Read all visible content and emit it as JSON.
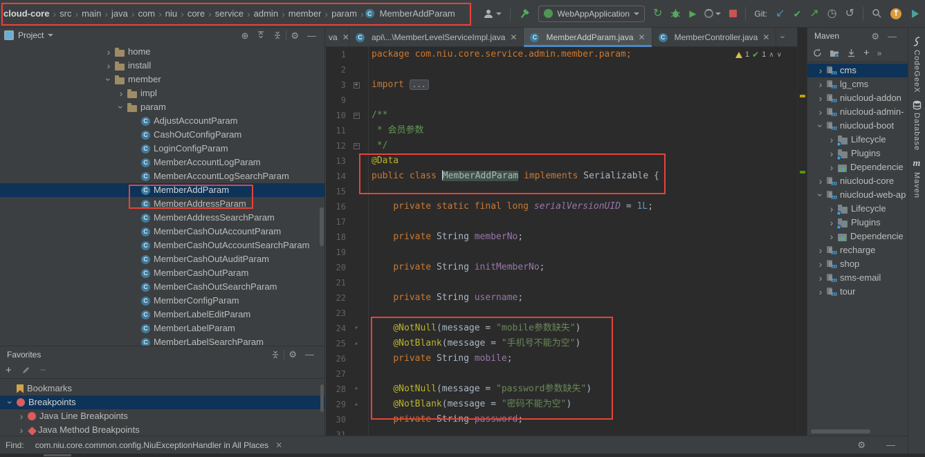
{
  "breadcrumbs": {
    "items": [
      "cloud-core",
      "src",
      "main",
      "java",
      "com",
      "niu",
      "core",
      "service",
      "admin",
      "member",
      "param",
      "MemberAddParam"
    ]
  },
  "toolbar": {
    "run_config": "WebAppApplication",
    "git_label": "Git:"
  },
  "project_panel": {
    "title": "Project"
  },
  "project_tree": {
    "items": [
      {
        "lv": 1,
        "chev": "r",
        "icon": "folder",
        "label": "home"
      },
      {
        "lv": 1,
        "chev": "r",
        "icon": "folder",
        "label": "install"
      },
      {
        "lv": 1,
        "chev": "d",
        "icon": "folder",
        "label": "member"
      },
      {
        "lv": 2,
        "chev": "r",
        "icon": "folder",
        "label": "impl"
      },
      {
        "lv": 2,
        "chev": "d",
        "icon": "folder",
        "label": "param"
      },
      {
        "lv": 3,
        "icon": "class",
        "label": "AdjustAccountParam"
      },
      {
        "lv": 3,
        "icon": "class",
        "label": "CashOutConfigParam"
      },
      {
        "lv": 3,
        "icon": "class",
        "label": "LoginConfigParam"
      },
      {
        "lv": 3,
        "icon": "class",
        "label": "MemberAccountLogParam"
      },
      {
        "lv": 3,
        "icon": "class",
        "label": "MemberAccountLogSearchParam"
      },
      {
        "lv": 3,
        "icon": "class",
        "label": "MemberAddParam",
        "sel": true
      },
      {
        "lv": 3,
        "icon": "class",
        "label": "MemberAddressParam"
      },
      {
        "lv": 3,
        "icon": "class",
        "label": "MemberAddressSearchParam"
      },
      {
        "lv": 3,
        "icon": "class",
        "label": "MemberCashOutAccountParam"
      },
      {
        "lv": 3,
        "icon": "class",
        "label": "MemberCashOutAccountSearchParam"
      },
      {
        "lv": 3,
        "icon": "class",
        "label": "MemberCashOutAuditParam"
      },
      {
        "lv": 3,
        "icon": "class",
        "label": "MemberCashOutParam"
      },
      {
        "lv": 3,
        "icon": "class",
        "label": "MemberCashOutSearchParam"
      },
      {
        "lv": 3,
        "icon": "class",
        "label": "MemberConfigParam"
      },
      {
        "lv": 3,
        "icon": "class",
        "label": "MemberLabelEditParam"
      },
      {
        "lv": 3,
        "icon": "class",
        "label": "MemberLabelParam"
      },
      {
        "lv": 3,
        "icon": "class",
        "label": "MemberLabelSearchParam"
      }
    ]
  },
  "favorites": {
    "title": "Favorites",
    "items": [
      {
        "lv": 1,
        "icon": "bookmark",
        "label": "Bookmarks"
      },
      {
        "lv": 0,
        "chev": "d",
        "icon": "bp",
        "label": "Breakpoints",
        "sel": true
      },
      {
        "lv": 2,
        "chev": "r",
        "icon": "bp",
        "label": "Java Line Breakpoints"
      },
      {
        "lv": 2,
        "chev": "r",
        "icon": "bpd",
        "label": "Java Method Breakpoints"
      }
    ]
  },
  "editor": {
    "tabs": [
      {
        "label": "va"
      },
      {
        "label": "api\\...\\MemberLevelServiceImpl.java"
      },
      {
        "label": "MemberAddParam.java",
        "selected": true
      },
      {
        "label": "MemberController.java"
      }
    ],
    "inspections": {
      "warnings": "1",
      "ok": "1"
    },
    "lines": [
      {
        "n": "1",
        "seg": [
          [
            "k",
            "package "
          ],
          [
            "p",
            "com.niu.core.service.admin.member.param;"
          ]
        ]
      },
      {
        "n": "2",
        "seg": []
      },
      {
        "n": "3",
        "g": "+",
        "seg": [
          [
            "k",
            "import "
          ],
          [
            "fold",
            "..."
          ]
        ]
      },
      {
        "n": "9",
        "seg": []
      },
      {
        "n": "10",
        "g": "-",
        "seg": [
          [
            "c",
            "/**"
          ]
        ]
      },
      {
        "n": "11",
        "seg": [
          [
            "c",
            " * 会员参数"
          ]
        ]
      },
      {
        "n": "12",
        "g": "-",
        "seg": [
          [
            "c",
            " */"
          ]
        ]
      },
      {
        "n": "13",
        "seg": [
          [
            "a",
            "@Data"
          ]
        ]
      },
      {
        "n": "14",
        "seg": [
          [
            "k",
            "public class "
          ],
          [
            "caret",
            ""
          ],
          [
            "hl",
            "MemberAddParam"
          ],
          [
            "k",
            " implements "
          ],
          [
            "t",
            "Serializable {"
          ]
        ]
      },
      {
        "n": "15",
        "seg": []
      },
      {
        "n": "16",
        "seg": [
          [
            "t",
            "    "
          ],
          [
            "k",
            "private static final long "
          ],
          [
            "sf",
            "serialVersionUID"
          ],
          [
            "t",
            " = "
          ],
          [
            "n2",
            "1L"
          ],
          [
            "t",
            ";"
          ]
        ]
      },
      {
        "n": "17",
        "seg": []
      },
      {
        "n": "18",
        "seg": [
          [
            "t",
            "    "
          ],
          [
            "k",
            "private "
          ],
          [
            "t",
            "String "
          ],
          [
            "f",
            "memberNo"
          ],
          [
            "t",
            ";"
          ]
        ]
      },
      {
        "n": "19",
        "seg": []
      },
      {
        "n": "20",
        "seg": [
          [
            "t",
            "    "
          ],
          [
            "k",
            "private "
          ],
          [
            "t",
            "String "
          ],
          [
            "f",
            "initMemberNo"
          ],
          [
            "t",
            ";"
          ]
        ]
      },
      {
        "n": "21",
        "seg": []
      },
      {
        "n": "22",
        "seg": [
          [
            "t",
            "    "
          ],
          [
            "k",
            "private "
          ],
          [
            "t",
            "String "
          ],
          [
            "f",
            "username"
          ],
          [
            "t",
            ";"
          ]
        ]
      },
      {
        "n": "23",
        "seg": []
      },
      {
        "n": "24",
        "g": "v",
        "seg": [
          [
            "t",
            "    "
          ],
          [
            "a",
            "@NotNull"
          ],
          [
            "t",
            "(message = "
          ],
          [
            "s",
            "\"mobile参数缺失\""
          ],
          [
            "t",
            ")"
          ]
        ]
      },
      {
        "n": "25",
        "g": "^",
        "seg": [
          [
            "t",
            "    "
          ],
          [
            "a",
            "@NotBlank"
          ],
          [
            "t",
            "(message = "
          ],
          [
            "s",
            "\"手机号不能为空\""
          ],
          [
            "t",
            ")"
          ]
        ]
      },
      {
        "n": "26",
        "seg": [
          [
            "t",
            "    "
          ],
          [
            "k",
            "private "
          ],
          [
            "t",
            "String "
          ],
          [
            "f",
            "mobile"
          ],
          [
            "t",
            ";"
          ]
        ]
      },
      {
        "n": "27",
        "seg": []
      },
      {
        "n": "28",
        "g": "v",
        "seg": [
          [
            "t",
            "    "
          ],
          [
            "a",
            "@NotNull"
          ],
          [
            "t",
            "(message = "
          ],
          [
            "s",
            "\"password参数缺失\""
          ],
          [
            "t",
            ")"
          ]
        ]
      },
      {
        "n": "29",
        "g": "^",
        "seg": [
          [
            "t",
            "    "
          ],
          [
            "a",
            "@NotBlank"
          ],
          [
            "t",
            "(message = "
          ],
          [
            "s",
            "\"密码不能为空\""
          ],
          [
            "t",
            ")"
          ]
        ]
      },
      {
        "n": "30",
        "seg": [
          [
            "t",
            "    "
          ],
          [
            "k",
            "private "
          ],
          [
            "t",
            "String "
          ],
          [
            "f",
            "password"
          ],
          [
            "t",
            ";"
          ]
        ]
      },
      {
        "n": "31",
        "seg": []
      }
    ]
  },
  "maven": {
    "title": "Maven",
    "items": [
      {
        "lv": 1,
        "chev": "r",
        "icon": "mvn",
        "label": "cms",
        "sel": true
      },
      {
        "lv": 1,
        "chev": "r",
        "icon": "mvn",
        "label": "lg_cms"
      },
      {
        "lv": 1,
        "chev": "r",
        "icon": "mvn",
        "label": "niucloud-addon"
      },
      {
        "lv": 1,
        "chev": "r",
        "icon": "mvn",
        "label": "niucloud-admin-"
      },
      {
        "lv": 1,
        "chev": "d",
        "icon": "mvn",
        "label": "niucloud-boot"
      },
      {
        "lv": 2,
        "chev": "r",
        "icon": "lifecycle",
        "label": "Lifecycle"
      },
      {
        "lv": 2,
        "chev": "r",
        "icon": "plugins",
        "label": "Plugins"
      },
      {
        "lv": 2,
        "chev": "r",
        "icon": "deps",
        "label": "Dependencie"
      },
      {
        "lv": 1,
        "chev": "r",
        "icon": "mvn",
        "label": "niucloud-core"
      },
      {
        "lv": 1,
        "chev": "d",
        "icon": "mvn",
        "label": "niucloud-web-ap"
      },
      {
        "lv": 2,
        "chev": "r",
        "icon": "lifecycle",
        "label": "Lifecycle"
      },
      {
        "lv": 2,
        "chev": "r",
        "icon": "plugins",
        "label": "Plugins"
      },
      {
        "lv": 2,
        "chev": "r",
        "icon": "deps",
        "label": "Dependencie"
      },
      {
        "lv": 1,
        "chev": "r",
        "icon": "mvn",
        "label": "recharge"
      },
      {
        "lv": 1,
        "chev": "r",
        "icon": "mvn",
        "label": "shop"
      },
      {
        "lv": 1,
        "chev": "r",
        "icon": "mvn",
        "label": "sms-email"
      },
      {
        "lv": 1,
        "chev": "r",
        "icon": "mvn",
        "label": "tour"
      }
    ]
  },
  "right_sidebar": {
    "items": [
      "CodeGeeX",
      "Database",
      "Maven"
    ]
  },
  "find_bar": {
    "label": "Find:",
    "query": "com.niu.core.common.config.NiuExceptionHandler in All Places"
  }
}
